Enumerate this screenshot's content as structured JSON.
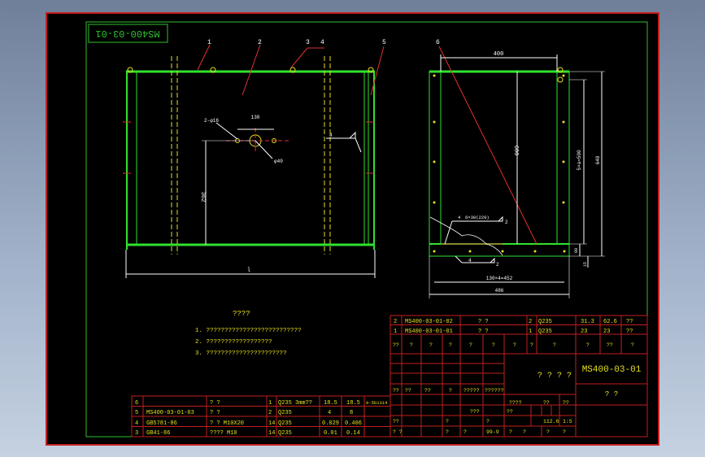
{
  "drawing": {
    "code": "MS400-03-01",
    "title_block_code": "MS400-03-01",
    "title_block_name": "? ?",
    "title_block_center": "? ? ? ?",
    "leaders": [
      "1",
      "2",
      "3",
      "4",
      "5",
      "6"
    ],
    "front_view_dims": {
      "spacing": "130",
      "hole_label": "2-φ16",
      "hole_dia": "φ40",
      "height": "362",
      "width": "l",
      "weld": "4"
    },
    "side_view_dims": {
      "top_width": "400",
      "inner_height": "600",
      "right_spacing": "5×a=500",
      "right_total": "640",
      "angle_note": "6×30(220)",
      "weld_a": "4",
      "weld_b": "4",
      "weld_2a": "2",
      "weld_2b": "2",
      "bottom_spacing": "130×4=452",
      "bottom_total": "486",
      "base_h": "80",
      "base_t": "15"
    }
  },
  "notes": {
    "title": "????",
    "items": [
      "1. ??????????????????????????",
      "2. ??????????????????",
      "3. ??????????????????????"
    ]
  },
  "upper_bom": [
    {
      "no": "2",
      "code": "MS400-03-01-02",
      "name": "?  ?",
      "qty": "2",
      "material": "Q235",
      "single": "31.3",
      "total": "62.6",
      "remark": "??"
    },
    {
      "no": "1",
      "code": "MS400-03-01-01",
      "name": "?  ?",
      "qty": "1",
      "material": "Q235",
      "single": "23",
      "total": "23",
      "remark": "??"
    }
  ],
  "upper_header": [
    "??",
    "?",
    "?",
    "?",
    "?",
    "?",
    "?",
    "?",
    "?",
    "?",
    "??",
    "?"
  ],
  "lower_bom": [
    {
      "no": "6",
      "code": "",
      "name": "?  ?",
      "qty": "1",
      "material": "Q235 3mm??",
      "single": "18.5",
      "total": "18.5",
      "remark": "0-5b1314"
    },
    {
      "no": "5",
      "code": "MS400-03-01-03",
      "name": "?  ?",
      "qty": "2",
      "material": "Q235",
      "single": "4",
      "total": "8",
      "remark": ""
    },
    {
      "no": "4",
      "code": "GB5781-86",
      "name": "?  ?  M10X20",
      "qty": "14",
      "material": "Q235",
      "single": "0.029",
      "total": "0.406",
      "remark": ""
    },
    {
      "no": "3",
      "code": "GB41-86",
      "name": "????  M10",
      "qty": "14",
      "material": "Q235",
      "single": "0.01",
      "total": "0.14",
      "remark": ""
    }
  ],
  "title_block": {
    "row_a": [
      "??",
      "??",
      "??",
      "?",
      "?????",
      "??????"
    ],
    "row_b": [
      "??",
      "?",
      "?"
    ],
    "row_c": [
      "?  ?",
      "?",
      "?",
      "99-9"
    ],
    "scale_label": "????",
    "mass": "112.6",
    "scale": "1:5",
    "mass_label": "??",
    "scale_hdr": "??",
    "sheet_labels": [
      "?",
      "?",
      "?",
      "?"
    ],
    "small_q": [
      "??",
      "???"
    ]
  }
}
